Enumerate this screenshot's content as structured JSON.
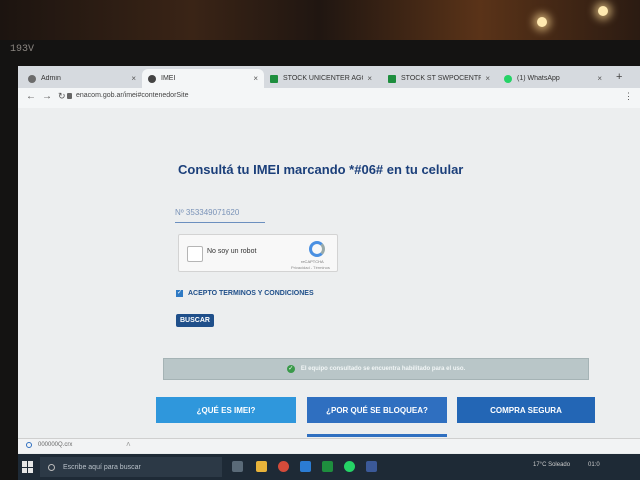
{
  "monitor": {
    "label": "193V"
  },
  "browser": {
    "tabs": [
      {
        "label": "Admin",
        "favicon": "admin-icon",
        "color": "#6b6b6b"
      },
      {
        "label": "IMEI",
        "favicon": "enacom-icon",
        "color": "#444444"
      },
      {
        "label": "STOCK UNICENTER AGOSTO",
        "favicon": "sheets-icon",
        "color": "#1e8e3e"
      },
      {
        "label": "STOCK ST SWPOCENTRAL -",
        "favicon": "sheets-icon",
        "color": "#1e8e3e"
      },
      {
        "label": "(1) WhatsApp",
        "favicon": "whatsapp-icon",
        "color": "#25d366"
      }
    ],
    "url": "enacom.gob.ar/imei#contenedorSite"
  },
  "page": {
    "heading": "Consultá tu IMEI marcando *#06# en tu celular",
    "imei_value": "Nº 353349071620",
    "captcha": {
      "label": "No soy un robot",
      "brand": "reCAPTCHA",
      "links": "Privacidad - Términos"
    },
    "terms_label": "ACEPTO TERMINOS Y CONDICIONES",
    "search_button": "BUSCAR",
    "result_message": "El equipo consultado se encuentra habilitado para el uso.",
    "nav": {
      "what_is_imei": "¿QUÉ ES IMEI?",
      "why_blocked": "¿POR QUÉ SE BLOQUEA?",
      "safe_purchase": "COMPRA SEGURA"
    }
  },
  "downloads": {
    "file": "000000Q.crx"
  },
  "taskbar": {
    "search_placeholder": "Escribe aquí para buscar",
    "weather": "17°C  Soleado",
    "time": "01:0"
  }
}
